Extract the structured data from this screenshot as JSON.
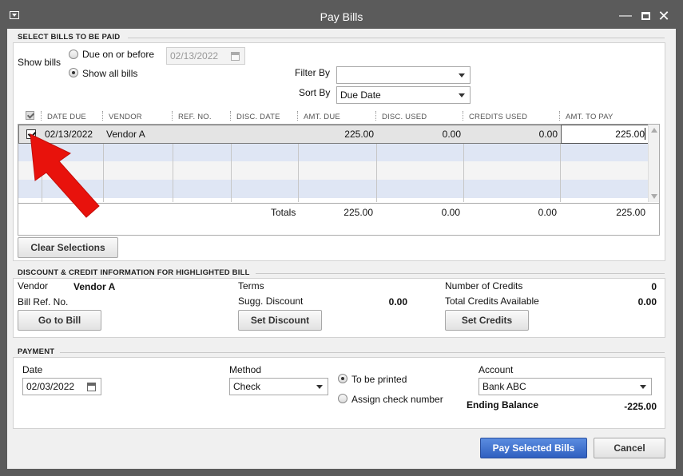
{
  "window": {
    "title": "Pay Bills"
  },
  "select_bills": {
    "section_title": "SELECT BILLS TO BE PAID",
    "show_bills_label": "Show bills",
    "due_on_before_label": "Due on or before",
    "due_on_before_date": "02/13/2022",
    "show_all_label": "Show all bills",
    "show_all_selected": true,
    "filter_by_label": "Filter By",
    "filter_by_value": "",
    "sort_by_label": "Sort By",
    "sort_by_value": "Due Date"
  },
  "table": {
    "columns": [
      "DATE DUE",
      "VENDOR",
      "REF. NO.",
      "DISC. DATE",
      "AMT. DUE",
      "DISC. USED",
      "CREDITS USED",
      "AMT. TO PAY"
    ],
    "rows": [
      {
        "checked": true,
        "date_due": "02/13/2022",
        "vendor": "Vendor A",
        "ref_no": "",
        "disc_date": "",
        "amt_due": "225.00",
        "disc_used": "0.00",
        "credits_used": "0.00",
        "amt_to_pay": "225.00"
      }
    ],
    "totals_label": "Totals",
    "totals": {
      "amt_due": "225.00",
      "disc_used": "0.00",
      "credits_used": "0.00",
      "amt_to_pay": "225.00"
    }
  },
  "clear_selections_label": "Clear Selections",
  "discount_credit": {
    "section_title": "DISCOUNT & CREDIT INFORMATION FOR HIGHLIGHTED BILL",
    "vendor_label": "Vendor",
    "vendor_value": "Vendor A",
    "bill_ref_label": "Bill Ref. No.",
    "terms_label": "Terms",
    "sugg_discount_label": "Sugg. Discount",
    "sugg_discount_value": "0.00",
    "num_credits_label": "Number of Credits",
    "num_credits_value": "0",
    "total_credits_label": "Total Credits Available",
    "total_credits_value": "0.00",
    "go_to_bill_label": "Go to Bill",
    "set_discount_label": "Set Discount",
    "set_credits_label": "Set Credits"
  },
  "payment": {
    "section_title": "PAYMENT",
    "date_label": "Date",
    "date_value": "02/03/2022",
    "method_label": "Method",
    "method_value": "Check",
    "to_be_printed_label": "To be printed",
    "to_be_printed_selected": true,
    "assign_check_label": "Assign check number",
    "account_label": "Account",
    "account_value": "Bank ABC",
    "ending_balance_label": "Ending Balance",
    "ending_balance_value": "-225.00"
  },
  "footer": {
    "pay_selected_label": "Pay Selected Bills",
    "cancel_label": "Cancel"
  },
  "colors": {
    "arrow": "#e8120c",
    "primary_button": "#3a6bd0",
    "selected_row_stripe": "#dfe6f4"
  }
}
